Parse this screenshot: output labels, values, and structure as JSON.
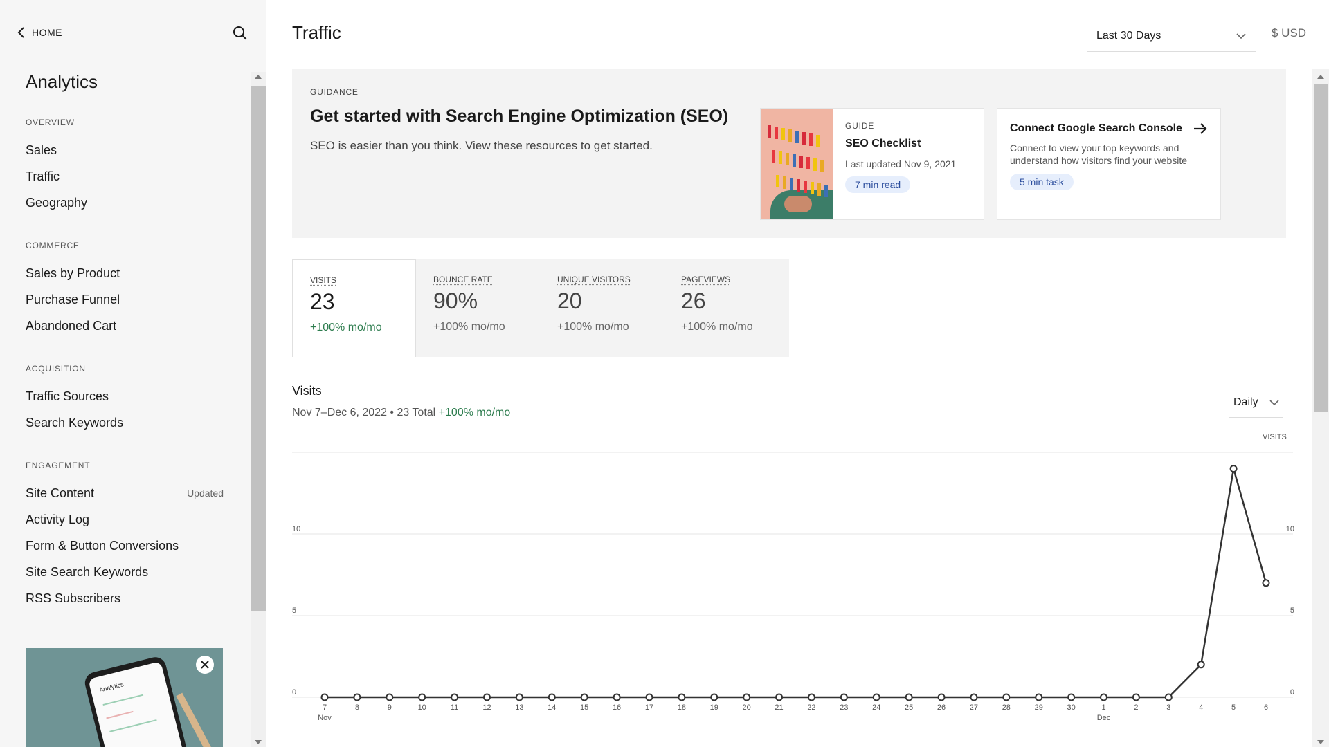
{
  "sidebar": {
    "home_label": "HOME",
    "title": "Analytics",
    "sections": [
      {
        "title": "OVERVIEW",
        "items": [
          {
            "label": "Sales",
            "badge": ""
          },
          {
            "label": "Traffic",
            "badge": ""
          },
          {
            "label": "Geography",
            "badge": ""
          }
        ]
      },
      {
        "title": "COMMERCE",
        "items": [
          {
            "label": "Sales by Product",
            "badge": ""
          },
          {
            "label": "Purchase Funnel",
            "badge": ""
          },
          {
            "label": "Abandoned Cart",
            "badge": ""
          }
        ]
      },
      {
        "title": "ACQUISITION",
        "items": [
          {
            "label": "Traffic Sources",
            "badge": ""
          },
          {
            "label": "Search Keywords",
            "badge": ""
          }
        ]
      },
      {
        "title": "ENGAGEMENT",
        "items": [
          {
            "label": "Site Content",
            "badge": "Updated"
          },
          {
            "label": "Activity Log",
            "badge": ""
          },
          {
            "label": "Form & Button Conversions",
            "badge": ""
          },
          {
            "label": "Site Search Keywords",
            "badge": ""
          },
          {
            "label": "RSS Subscribers",
            "badge": ""
          }
        ]
      }
    ],
    "promo_screen_title": "Analytics"
  },
  "header": {
    "title": "Traffic",
    "date_range": "Last 30 Days",
    "currency": "$ USD"
  },
  "guidance": {
    "label": "GUIDANCE",
    "title": "Get started with Search Engine Optimization (SEO)",
    "description": "SEO is easier than you think. View these resources to get started.",
    "card1": {
      "kicker": "GUIDE",
      "title": "SEO Checklist",
      "meta": "Last updated Nov 9, 2021",
      "pill": "7 min read"
    },
    "card2": {
      "title": "Connect Google Search Console",
      "description": "Connect to view your top keywords and understand how visitors find your website",
      "pill": "5 min task"
    }
  },
  "metrics": [
    {
      "label": "VISITS",
      "value": "23",
      "change": "+100% mo/mo",
      "active": true
    },
    {
      "label": "BOUNCE RATE",
      "value": "90%",
      "change": "+100% mo/mo",
      "active": false
    },
    {
      "label": "UNIQUE VISITORS",
      "value": "20",
      "change": "+100% mo/mo",
      "active": false
    },
    {
      "label": "PAGEVIEWS",
      "value": "26",
      "change": "+100% mo/mo",
      "active": false
    }
  ],
  "chart_section": {
    "title": "Visits",
    "range_text": "Nov 7–Dec 6, 2022 • 23 Total",
    "change_text": "+100% mo/mo",
    "interval": "Daily",
    "right_axis_label": "VISITS"
  },
  "chart_data": {
    "type": "line",
    "x": [
      "7",
      "8",
      "9",
      "10",
      "11",
      "12",
      "13",
      "14",
      "15",
      "16",
      "17",
      "18",
      "19",
      "20",
      "21",
      "22",
      "23",
      "24",
      "25",
      "26",
      "27",
      "28",
      "29",
      "30",
      "1",
      "2",
      "3",
      "4",
      "5",
      "6"
    ],
    "month_labels": [
      {
        "index": 0,
        "label": "Nov"
      },
      {
        "index": 24,
        "label": "Dec"
      }
    ],
    "series": [
      {
        "values": [
          0,
          0,
          0,
          0,
          0,
          0,
          0,
          0,
          0,
          0,
          0,
          0,
          0,
          0,
          0,
          0,
          0,
          0,
          0,
          0,
          0,
          0,
          0,
          0,
          0,
          0,
          0,
          2,
          14,
          7
        ]
      }
    ],
    "ylim": [
      0,
      15
    ],
    "yticks": [
      0,
      5,
      10,
      15
    ],
    "grid": true,
    "line_color": "#333333"
  },
  "colors": {
    "accent_green": "#2e7d4f",
    "pill_bg": "#e6eefc",
    "pill_text": "#2d4f9e"
  }
}
